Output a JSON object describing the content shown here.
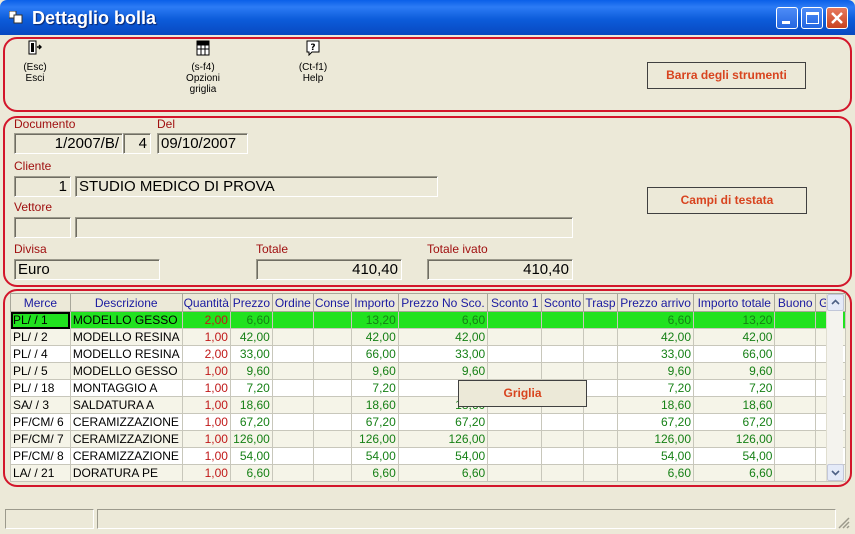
{
  "window": {
    "title": "Dettaglio bolla"
  },
  "toolbar": {
    "exit": {
      "shortcut": "(Esc)",
      "label": "Esci"
    },
    "grid_options": {
      "shortcut": "(s-f4)",
      "label1": "Opzioni",
      "label2": "griglia"
    },
    "help": {
      "shortcut": "(Ct-f1)",
      "label": "Help"
    }
  },
  "annotations": {
    "toolbar": "Barra degli strumenti",
    "header": "Campi di testata",
    "grid": "Griglia"
  },
  "header": {
    "documento": {
      "label": "Documento",
      "value": "1/2007/B/",
      "num": "4"
    },
    "del": {
      "label": "Del",
      "value": "09/10/2007"
    },
    "cliente": {
      "label": "Cliente",
      "code": "1",
      "name": "STUDIO MEDICO DI PROVA"
    },
    "vettore": {
      "label": "Vettore",
      "code": "",
      "name": ""
    },
    "divisa": {
      "label": "Divisa",
      "value": "Euro"
    },
    "totale": {
      "label": "Totale",
      "value": "410,40"
    },
    "totale_ivato": {
      "label": "Totale ivato",
      "value": "410,40"
    }
  },
  "grid": {
    "columns": [
      "Merce",
      "Descrizione",
      "Quantità",
      "Prezzo",
      "Ordine",
      "Conse",
      "Importo",
      "Prezzo No Sco.",
      "Sconto 1",
      "Sconto",
      "Trasp",
      "Prezzo arrivo",
      "Importo totale",
      "Buono",
      "Giro"
    ],
    "rows": [
      [
        "PL/  /    1",
        "MODELLO GESSO",
        "2,00",
        "6,60",
        "",
        "",
        "13,20",
        "6,60",
        "",
        "",
        "",
        "6,60",
        "13,20",
        "",
        ""
      ],
      [
        "PL/  /    2",
        "MODELLO RESINA",
        "1,00",
        "42,00",
        "",
        "",
        "42,00",
        "42,00",
        "",
        "",
        "",
        "42,00",
        "42,00",
        "",
        ""
      ],
      [
        "PL/  /    4",
        "MODELLO RESINA",
        "2,00",
        "33,00",
        "",
        "",
        "66,00",
        "33,00",
        "",
        "",
        "",
        "33,00",
        "66,00",
        "",
        ""
      ],
      [
        "PL/  /    5",
        "MODELLO GESSO",
        "1,00",
        "9,60",
        "",
        "",
        "9,60",
        "9,60",
        "",
        "",
        "",
        "9,60",
        "9,60",
        "",
        ""
      ],
      [
        "PL/  /   18",
        "MONTAGGIO A",
        "1,00",
        "7,20",
        "",
        "",
        "7,20",
        "7,20",
        "",
        "",
        "",
        "7,20",
        "7,20",
        "",
        ""
      ],
      [
        "SA/  /    3",
        "SALDATURA A",
        "1,00",
        "18,60",
        "",
        "",
        "18,60",
        "18,60",
        "",
        "",
        "",
        "18,60",
        "18,60",
        "",
        ""
      ],
      [
        "PF/CM/    6",
        "CERAMIZZAZIONE",
        "1,00",
        "67,20",
        "",
        "",
        "67,20",
        "67,20",
        "",
        "",
        "",
        "67,20",
        "67,20",
        "",
        ""
      ],
      [
        "PF/CM/    7",
        "CERAMIZZAZIONE",
        "1,00",
        "126,00",
        "",
        "",
        "126,00",
        "126,00",
        "",
        "",
        "",
        "126,00",
        "126,00",
        "",
        ""
      ],
      [
        "PF/CM/    8",
        "CERAMIZZAZIONE",
        "1,00",
        "54,00",
        "",
        "",
        "54,00",
        "54,00",
        "",
        "",
        "",
        "54,00",
        "54,00",
        "",
        ""
      ],
      [
        "LA/  /   21",
        "DORATURA PE",
        "1,00",
        "6,60",
        "",
        "",
        "6,60",
        "6,60",
        "",
        "",
        "",
        "6,60",
        "6,60",
        "",
        ""
      ]
    ],
    "selected_row": 0
  },
  "icons": {
    "exit": "door-exit-icon",
    "grid_options": "grid-options-icon",
    "help": "help-icon",
    "scroll_up": "scroll-up-icon",
    "scroll_down": "scroll-down-icon",
    "resize_grip": "resize-grip-icon"
  },
  "colors": {
    "titlebar": "#0A5FE8",
    "annotation_border": "#D3162B",
    "annotation_text": "#D8441F",
    "label_text": "#A01010",
    "selected_row": "#21E21F",
    "numeric_text": "#168016",
    "quantity_text": "#C01818"
  }
}
